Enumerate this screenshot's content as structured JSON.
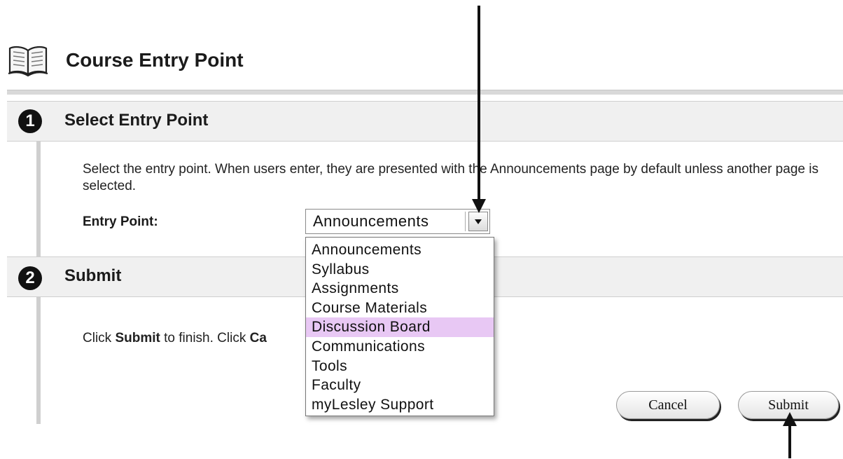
{
  "header": {
    "title": "Course Entry Point",
    "icon": "book-icon"
  },
  "step1": {
    "number": "1",
    "title": "Select Entry Point",
    "instructions": "Select the entry point. When users enter, they are presented with the Announcements page by default unless another page is selected.",
    "field_label": "Entry Point:",
    "selected_value": "Announcements",
    "options": [
      "Announcements",
      "Syllabus",
      "Assignments",
      "Course Materials",
      "Discussion Board",
      "Communications",
      "Tools",
      "Faculty",
      "myLesley Support"
    ],
    "highlighted_option": "Discussion Board",
    "highlight_color": "#e8c8f4"
  },
  "step2": {
    "number": "2",
    "title": "Submit",
    "text_prefix": "Click ",
    "text_submit": "Submit",
    "text_middle": " to finish. Click ",
    "text_cancel": "Ca"
  },
  "buttons": {
    "cancel_label": "Cancel",
    "submit_label": "Submit"
  }
}
